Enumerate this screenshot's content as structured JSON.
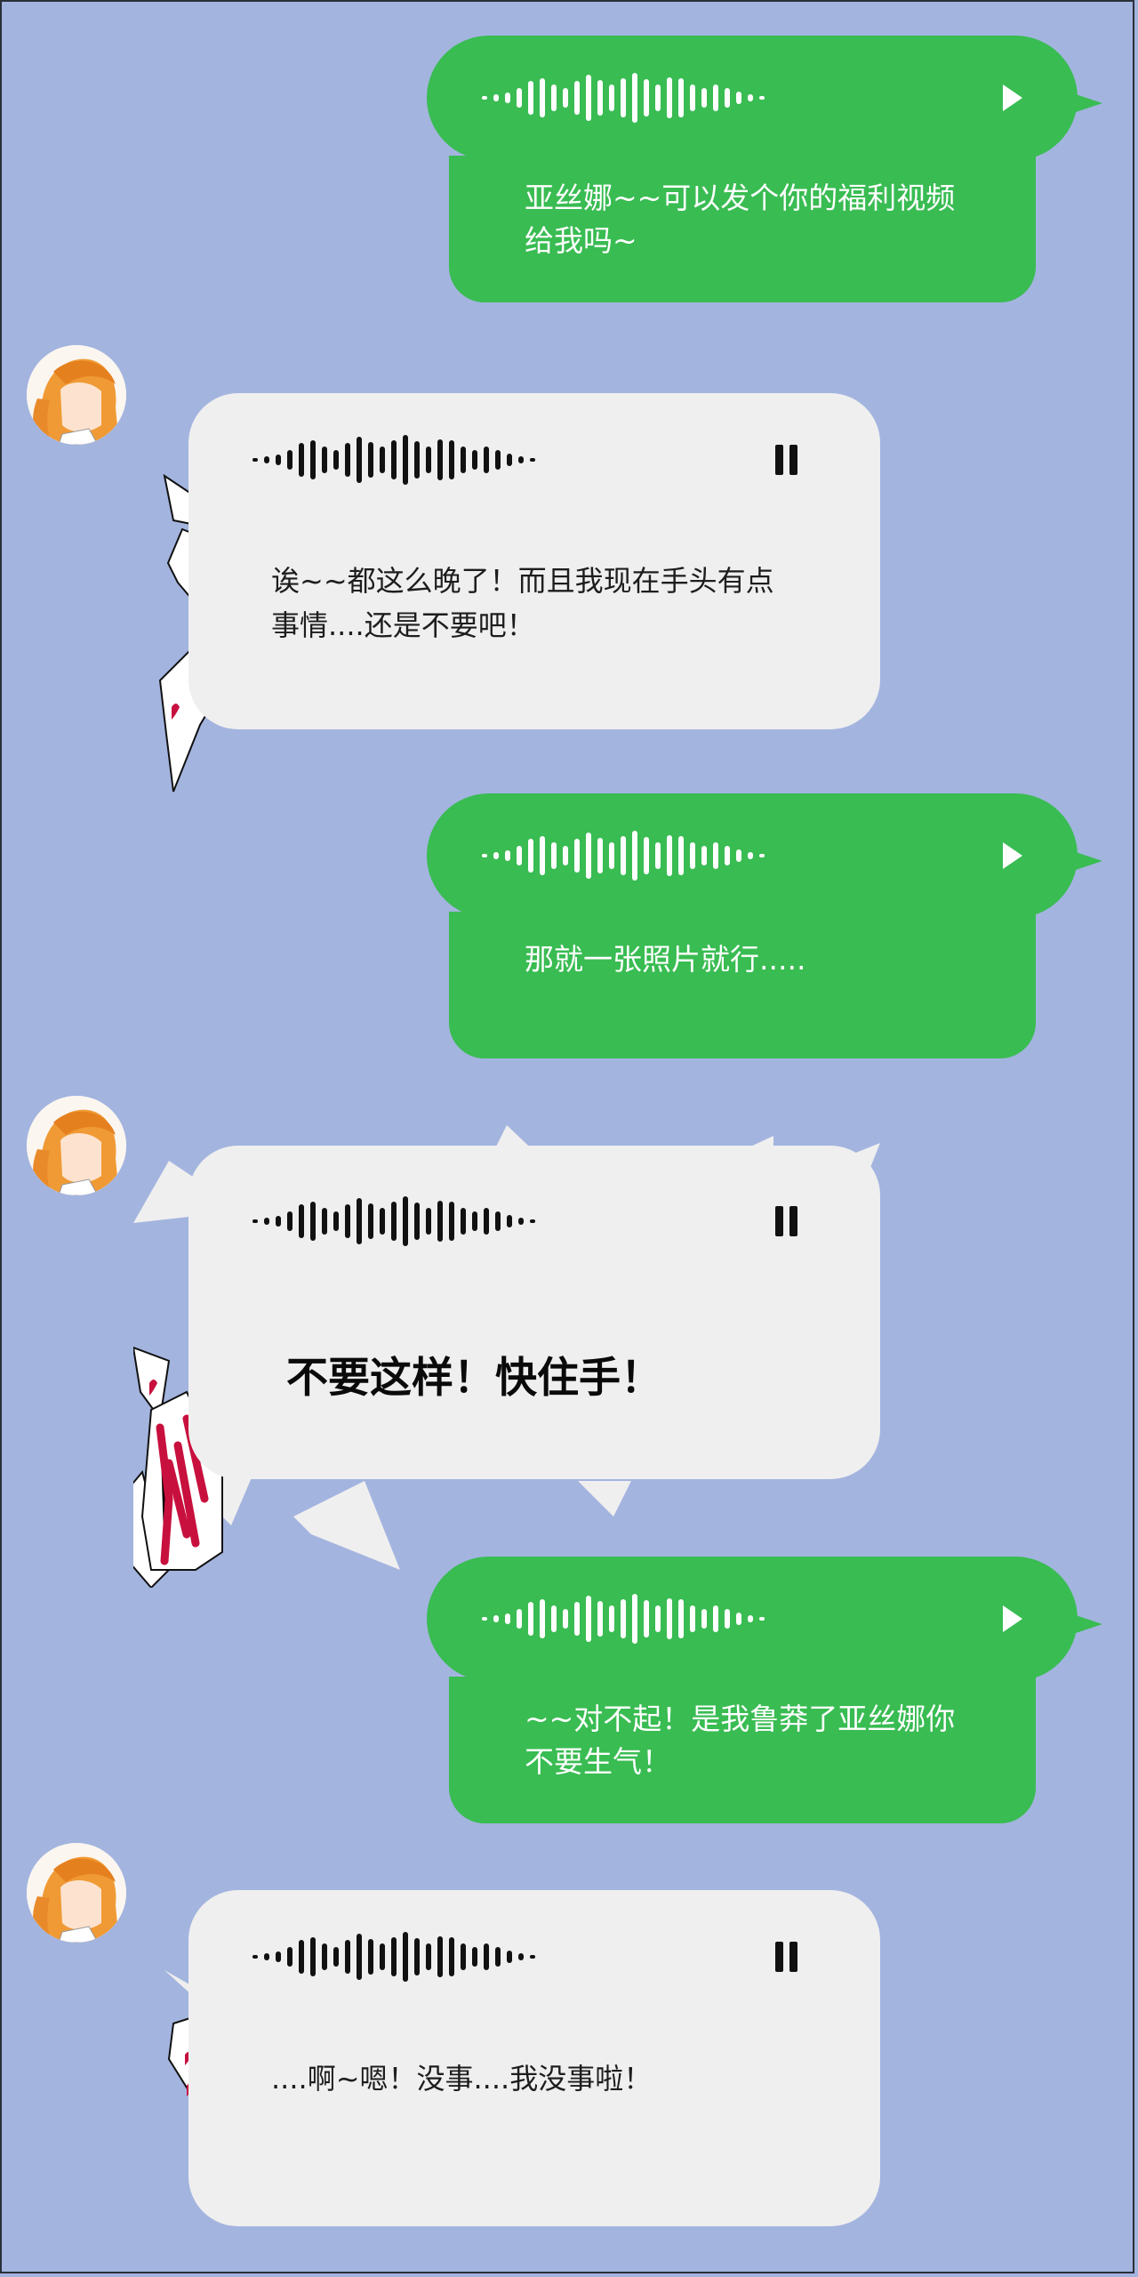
{
  "messages": [
    {
      "side": "out",
      "text": "亚丝娜~~可以发个你的福利视频\n给我吗~"
    },
    {
      "side": "in",
      "text": "诶~~都这么晚了！而且我现在手头有点\n事情....还是不要吧！"
    },
    {
      "side": "out",
      "text": "那就一张照片就行....."
    },
    {
      "side": "in",
      "text": "不要这样！快住手！"
    },
    {
      "side": "out",
      "text": "~~对不起！是我鲁莽了亚丝娜你\n不要生气！"
    },
    {
      "side": "in",
      "text": "....啊~嗯！没事....我没事啦！"
    }
  ],
  "waveform": [
    4,
    8,
    12,
    22,
    38,
    44,
    30,
    22,
    38,
    52,
    40,
    30,
    44,
    56,
    42,
    30,
    46,
    44,
    30,
    22,
    30,
    22,
    14,
    8,
    4
  ],
  "colors": {
    "background": "#a3b4df",
    "outgoing": "#39bc52",
    "incoming": "#efefef",
    "heart": "#c8103e"
  },
  "icons": {
    "outgoing_control": "play-icon",
    "incoming_control": "pause-icon"
  }
}
